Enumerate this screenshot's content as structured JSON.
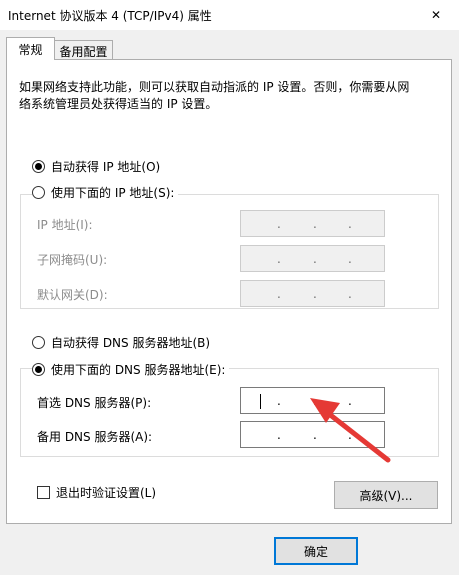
{
  "window": {
    "title": "Internet 协议版本 4 (TCP/IPv4) 属性",
    "close_glyph": "✕"
  },
  "tabs": [
    {
      "label": "常规",
      "active": true
    },
    {
      "label": "备用配置",
      "active": false
    }
  ],
  "description": {
    "line1": "如果网络支持此功能，则可以获取自动指派的 IP 设置。否则，你需要从网",
    "line2": "络系统管理员处获得适当的 IP 设置。"
  },
  "ip_options": {
    "auto_label": "自动获得 IP 地址(O)",
    "manual_label": "使用下面的 IP 地址(S):",
    "selected": "auto",
    "fields": [
      {
        "label": "IP 地址(I):",
        "value": ""
      },
      {
        "label": "子网掩码(U):",
        "value": ""
      },
      {
        "label": "默认网关(D):",
        "value": ""
      }
    ]
  },
  "dns_options": {
    "auto_label": "自动获得 DNS 服务器地址(B)",
    "manual_label": "使用下面的 DNS 服务器地址(E):",
    "selected": "manual",
    "fields": [
      {
        "label": "首选 DNS 服务器(P):",
        "value": ""
      },
      {
        "label": "备用 DNS 服务器(A):",
        "value": ""
      }
    ]
  },
  "ip_separator": ".",
  "validate_on_exit": {
    "label": "退出时验证设置(L)",
    "checked": false
  },
  "buttons": {
    "advanced": "高级(V)...",
    "ok": "确定"
  },
  "colors": {
    "focus_border": "#0078d7",
    "annotation_arrow": "#e53935"
  }
}
